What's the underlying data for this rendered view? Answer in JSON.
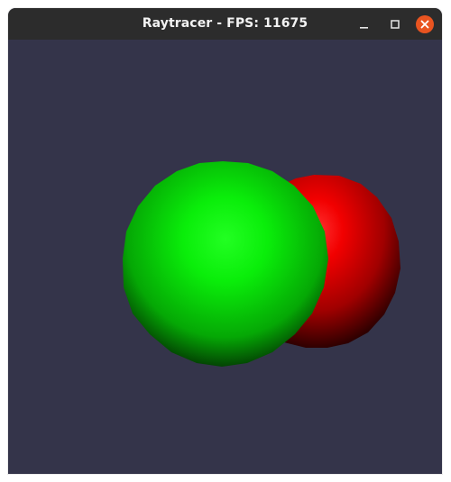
{
  "window": {
    "title": "Raytracer - FPS: 11675",
    "controls": {
      "minimize_icon": "minimize-icon",
      "maximize_icon": "maximize-icon",
      "close_icon": "close-icon"
    }
  },
  "scene": {
    "background_color": "#34344a",
    "spheres": [
      {
        "name": "red-sphere",
        "color": "#ff0000"
      },
      {
        "name": "green-sphere",
        "color": "#00ff00"
      }
    ]
  },
  "colors": {
    "titlebar": "#2c2c2c",
    "close_button": "#e95420"
  }
}
